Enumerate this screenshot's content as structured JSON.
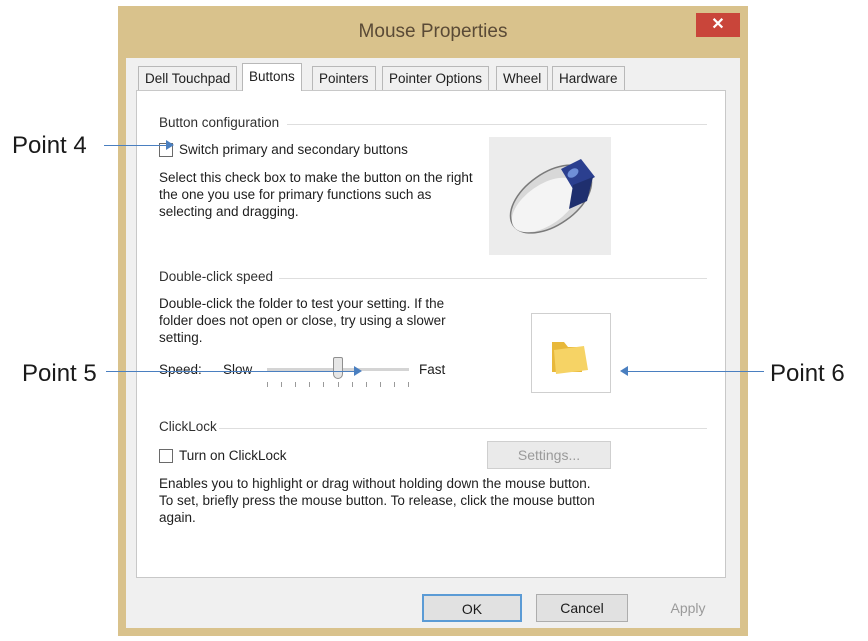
{
  "window": {
    "title": "Mouse Properties",
    "close_glyph": "✕"
  },
  "tabs": [
    {
      "label": "Dell Touchpad"
    },
    {
      "label": "Buttons"
    },
    {
      "label": "Pointers"
    },
    {
      "label": "Pointer Options"
    },
    {
      "label": "Wheel"
    },
    {
      "label": "Hardware"
    }
  ],
  "button_config": {
    "heading": "Button configuration",
    "checkbox_label": "Switch primary and secondary buttons",
    "checked": false,
    "description": "Select this check box to make the button on the right the one you use for primary functions such as selecting and dragging.",
    "image_icon": "mouse-icon"
  },
  "double_click": {
    "heading": "Double-click speed",
    "description": "Double-click the folder to test your setting. If the folder does not open or close, try using a slower setting.",
    "speed_label": "Speed:",
    "slow_label": "Slow",
    "fast_label": "Fast",
    "slider_value_fraction": 0.5,
    "test_icon": "folder-icon"
  },
  "clicklock": {
    "heading": "ClickLock",
    "checkbox_label": "Turn on ClickLock",
    "checked": false,
    "settings_label": "Settings...",
    "description": "Enables you to highlight or drag without holding down the mouse button. To set, briefly press the mouse button. To release, click the mouse button again."
  },
  "footer": {
    "ok": "OK",
    "cancel": "Cancel",
    "apply": "Apply"
  },
  "annotations": {
    "point4": "Point 4",
    "point5": "Point 5",
    "point6": "Point 6"
  },
  "colors": {
    "frame": "#d9c28c",
    "close": "#c9453a",
    "arrow": "#4a7fc0",
    "folder": "#f2c94c"
  }
}
